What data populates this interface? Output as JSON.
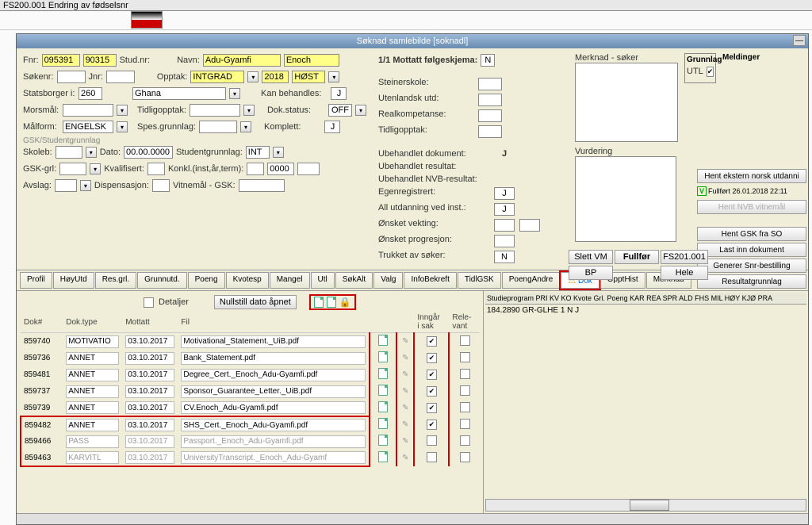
{
  "topbar": {
    "title": "FS200.001 Endring av fødselsnr"
  },
  "window": {
    "title": "Søknad samlebilde  [soknadl]"
  },
  "form": {
    "fnr_lbl": "Fnr:",
    "fnr1": "095391",
    "fnr2": "90315",
    "studnr_lbl": "Stud.nr:",
    "navn_lbl": "Navn:",
    "navn1": "Adu-Gyamfi",
    "navn2": "Enoch",
    "sokenr_lbl": "Søkenr:",
    "jnr_lbl": "Jnr:",
    "opptak_lbl": "Opptak:",
    "opptak": "INTGRAD",
    "year": "2018",
    "term": "HØST",
    "stats_lbl": "Statsborger i:",
    "stats_code": "260",
    "stats_country": "Ghana",
    "kanb_lbl": "Kan behandles:",
    "kanb": "J",
    "morsmal_lbl": "Morsmål:",
    "tidlig_lbl": "Tidligopptak:",
    "doks_lbl": "Dok.status:",
    "doks": "OFF",
    "malform_lbl": "Målform:",
    "malform": "ENGELSK",
    "spes_lbl": "Spes.grunnlag:",
    "komplett_lbl": "Komplett:",
    "komplett": "J",
    "gsk_lbl": "GSK/Studentgrunnlag",
    "skoleb_lbl": "Skoleb:",
    "dato_lbl": "Dato:",
    "dato": "00.00.0000",
    "studgr_lbl": "Studentgrunnlag:",
    "studgr": "INT",
    "gskgrl_lbl": "GSK-grl:",
    "kval_lbl": "Kvalifisert:",
    "konkl_lbl": "Konkl.(inst,år,term):",
    "konkl_year": "0000",
    "avslag_lbl": "Avslag:",
    "disp_lbl": "Dispensasjon:",
    "vitne_lbl": "Vitnemål - GSK:"
  },
  "mottatt": {
    "hdr": "1/1 Mottatt følgeskjema:",
    "val": "N",
    "merknad_lbl": "Merknad - søker",
    "stein_lbl": "Steinerskole:",
    "uten_lbl": "Utenlandsk utd:",
    "real_lbl": "Realkompetanse:",
    "tidl_lbl": "Tidligopptak:"
  },
  "vurdering_lbl": "Vurdering",
  "status2": {
    "ubeh1": "Ubehandlet dokument:",
    "ubeh1v": "J",
    "ubeh2": "Ubehandlet resultat:",
    "ubeh3": "Ubehandlet NVB-resultat:",
    "egen": "Egenregistrert:",
    "egenv": "J",
    "allutd": "All utdanning ved inst.:",
    "allutdv": "J",
    "vekt": "Ønsket vekting:",
    "prog": "Ønsket progresjon:",
    "trukk": "Trukket av søker:",
    "trukkv": "N"
  },
  "buttons": {
    "slettvm": "Slett VM",
    "bp": "BP",
    "fullfor": "Fullfør",
    "fs201": "FS201.001",
    "hele": "Hele"
  },
  "grunnlag": {
    "hdr": "Grunnlag",
    "val": "UTL"
  },
  "meldinger_hdr": "Meldinger",
  "rbtns": {
    "hent_ekstern": "Hent ekstern norsk utdanni",
    "fullfort": "Fullført 26.01.2018 22:11",
    "hent_nvb": "Hent NVB vitnemål",
    "hent_gsk": "Hent GSK fra SO",
    "last_inn": "Last inn dokument",
    "generer": "Generer Snr-bestilling",
    "resultat": "Resultatgrunnlag"
  },
  "tabs": [
    "Profil",
    "HøyUtd",
    "Res.grl.",
    "Grunnutd.",
    "Poeng",
    "Kvotesp",
    "Mangel",
    "Utl",
    "SøkAlt",
    "Valg",
    "InfoBekreft",
    "TidlGSK",
    "PoengAndre",
    "Dok",
    "OpptHist",
    "Merknad"
  ],
  "active_tab": 13,
  "doc": {
    "detaljer_lbl": "Detaljer",
    "nullstill_btn": "Nullstill dato åpnet",
    "cols": {
      "dok": "Dok#",
      "type": "Dok.type",
      "mottatt": "Mottatt",
      "fil": "Fil",
      "inngar": "Inngår\ni sak",
      "rele": "Rele-\nvant"
    },
    "rows": [
      {
        "id": "859740",
        "type": "MOTIVATIO",
        "dato": "03.10.2017",
        "fil": "Motivational_Statement._UiB.pdf",
        "sak": true,
        "rel": false,
        "dim": false
      },
      {
        "id": "859736",
        "type": "ANNET",
        "dato": "03.10.2017",
        "fil": "Bank_Statement.pdf",
        "sak": true,
        "rel": false,
        "dim": false
      },
      {
        "id": "859481",
        "type": "ANNET",
        "dato": "03.10.2017",
        "fil": "Degree_Cert._Enoch_Adu-Gyamfi.pdf",
        "sak": true,
        "rel": false,
        "dim": false
      },
      {
        "id": "859737",
        "type": "ANNET",
        "dato": "03.10.2017",
        "fil": "Sponsor_Guarantee_Letter._UiB.pdf",
        "sak": true,
        "rel": false,
        "dim": false
      },
      {
        "id": "859739",
        "type": "ANNET",
        "dato": "03.10.2017",
        "fil": "CV.Enoch_Adu-Gyamfi.pdf",
        "sak": true,
        "rel": false,
        "dim": false
      },
      {
        "id": "859482",
        "type": "ANNET",
        "dato": "03.10.2017",
        "fil": "SHS_Cert._Enoch_Adu-Gyamfi.pdf",
        "sak": true,
        "rel": false,
        "dim": false
      },
      {
        "id": "859466",
        "type": "PASS",
        "dato": "03.10.2017",
        "fil": "Passport._Enoch_Adu-Gyamfi.pdf",
        "sak": false,
        "rel": false,
        "dim": true
      },
      {
        "id": "859463",
        "type": "KARVITL",
        "dato": "03.10.2017",
        "fil": "UniversityTranscript._Enoch_Adu-Gyamf",
        "sak": false,
        "rel": false,
        "dim": true
      }
    ]
  },
  "study": {
    "hdr": "Studieprogram                           PRI KV KO Kvote         Grl.   Poeng   KAR REA  SPR ALD FHS MIL HØY KJØ PRA",
    "row": "184.2890   GR-GLHE                 1   N   J"
  }
}
